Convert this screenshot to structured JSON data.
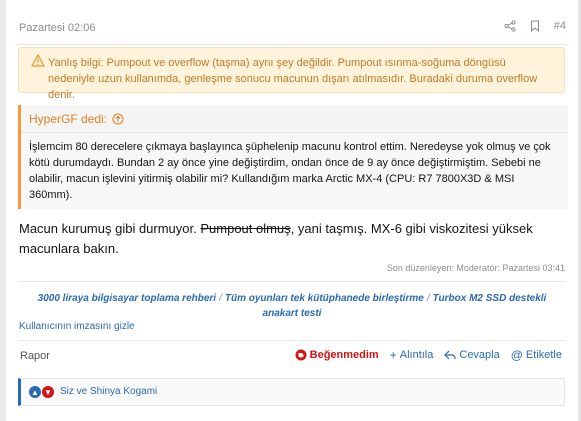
{
  "post": {
    "date": "Pazartesi 02:06",
    "number": "#4"
  },
  "warning": {
    "text": "Yanlış bilgi: Pumpout ve overflow (taşma) aynı şey değildir. Pumpout ısınma-soğuma döngüsü nedeniyle uzun kullanımda, genleşme sonucu macunun dışarı atılmasıdır. Buradaki duruma overflow denir."
  },
  "quote": {
    "author_label": "HyperGF dedi:",
    "body": "İşlemcim 80 derecelere çıkmaya başlayınca şüphelenip macunu kontrol ettim. Neredeyse yok olmuş ve çok kötü durumdaydı. Bundan 2 ay önce yine değiştirdim, ondan önce de 9 ay önce değiştirmiştim. Sebebi ne olabilir, macun işlevini yitirmiş olabilir mi? Kullandığım marka Arctic MX-4 (CPU: R7 7800X3D & MSI 360mm)."
  },
  "message": {
    "part1": "Macun kurumuş gibi durmuyor. ",
    "struck": "Pumpout olmuş",
    "part2": ", yani taşmış. MX-6 gibi viskozitesi yüksek macunlara bakın."
  },
  "edited": "Son düzenleyen: Moderatör: Pazartesi 03:41",
  "signature": {
    "links": [
      "3000 liraya bilgisayar toplama rehberi",
      "Tüm oyunları tek kütüphanede birleştirme",
      "Turbox M2 SSD destekli anakart testi"
    ],
    "separator": "/"
  },
  "hide_signature": "Kullanıcının imzasını gizle",
  "actions": {
    "report": "Rapor",
    "dislike": "Beğenmedim",
    "quote": "Alıntıla",
    "reply": "Cevapla",
    "tag": "Etiketle"
  },
  "reactions": {
    "text": "Siz ve Shinya Kogami"
  },
  "colors": {
    "accent": "#2a6ab0",
    "warning_bg": "#fff3dc",
    "warning_text": "#c27a25",
    "quote_border": "#f39a3c",
    "dislike": "#d11515"
  },
  "icons": {
    "share": "share-icon",
    "bookmark": "bookmark-icon",
    "warning": "warning-triangle-icon",
    "quote_arrow": "arrow-up-circle-icon"
  }
}
